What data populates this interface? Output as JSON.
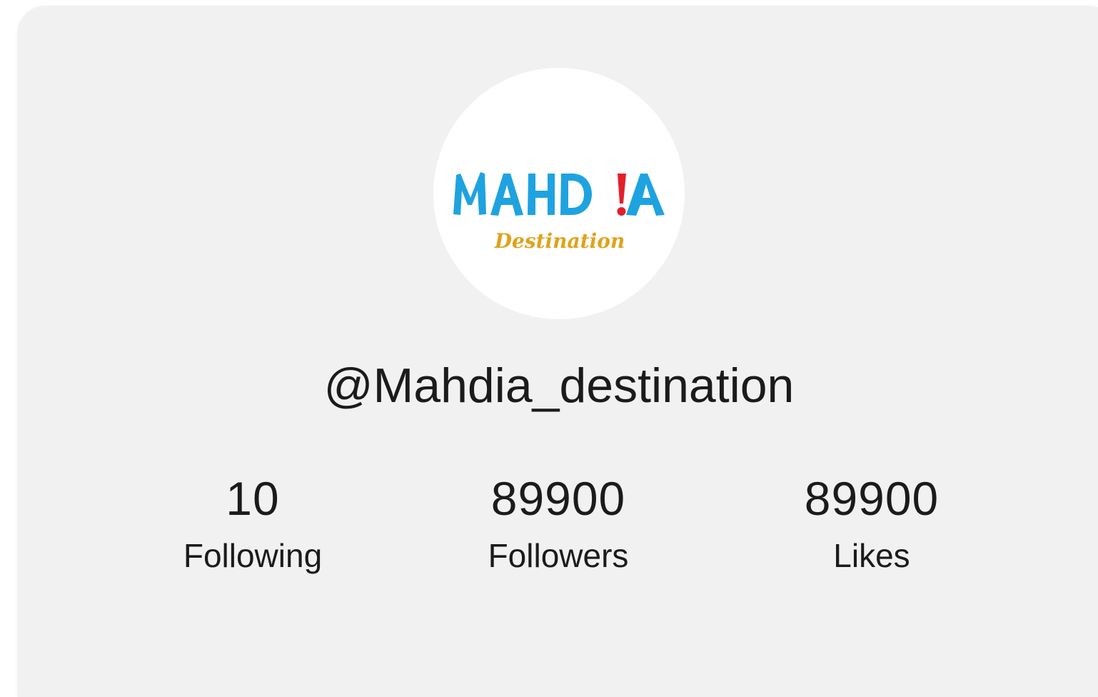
{
  "profile": {
    "avatar": {
      "logo_main": "MAHD!A",
      "logo_sub": "Destination",
      "colors": {
        "main": "#1ea3e0",
        "exclamation": "#e3202a",
        "sub": "#e0a21c"
      }
    },
    "handle": "@Mahdia_destination"
  },
  "stats": [
    {
      "value": "10",
      "label": "Following"
    },
    {
      "value": "89900",
      "label": "Followers"
    },
    {
      "value": "89900",
      "label": "Likes"
    }
  ],
  "colors": {
    "card_background": "#f1f1f1",
    "text": "#1b1b1b"
  }
}
